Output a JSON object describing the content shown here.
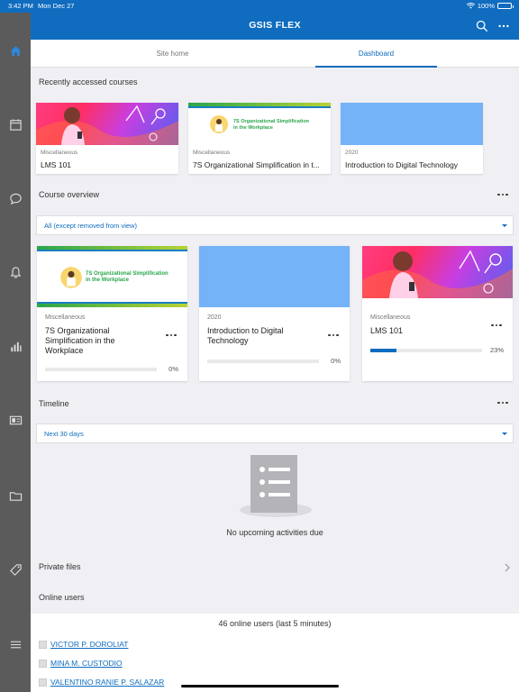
{
  "status": {
    "time": "3:42 PM",
    "date": "Mon Dec 27",
    "battery": "100%"
  },
  "header": {
    "title": "GSIS FLEX",
    "search_icon": "search-icon",
    "more_icon": "more-horizontal-icon"
  },
  "tabs": [
    {
      "label": "Site home",
      "active": false
    },
    {
      "label": "Dashboard",
      "active": true
    }
  ],
  "sidebar": {
    "items": [
      {
        "icon": "home-icon",
        "active": true
      },
      {
        "icon": "calendar-icon"
      },
      {
        "icon": "chat-bubble-icon"
      },
      {
        "icon": "bell-icon"
      },
      {
        "icon": "bar-chart-icon"
      },
      {
        "icon": "id-card-icon"
      },
      {
        "icon": "folder-icon"
      },
      {
        "icon": "tag-icon"
      },
      {
        "icon": "menu-icon"
      }
    ]
  },
  "recent": {
    "title": "Recently accessed courses",
    "courses": [
      {
        "category": "Miscellaneous",
        "name": "LMS 101",
        "image": "pink"
      },
      {
        "category": "Miscellaneous",
        "name": "7S Organizational Simplification in t...",
        "image": "7s"
      },
      {
        "category": "2020",
        "name": "Introduction to Digital Technology",
        "image": "blue"
      }
    ]
  },
  "overview": {
    "title": "Course overview",
    "filter": "All (except removed from view)",
    "courses": [
      {
        "category": "Miscellaneous",
        "name": "7S Organizational Simplification in the Workplace",
        "progress": 0,
        "progress_label": "0%",
        "image": "7s"
      },
      {
        "category": "2020",
        "name": "Introduction to Digital Technology",
        "progress": 0,
        "progress_label": "0%",
        "image": "blue"
      },
      {
        "category": "Miscellaneous",
        "name": "LMS 101",
        "progress": 23,
        "progress_label": "23%",
        "image": "pink"
      }
    ],
    "banner_text_line1": "7S Organizational Simplification",
    "banner_text_line2": "in the Workplace"
  },
  "timeline": {
    "title": "Timeline",
    "filter": "Next 30 days",
    "empty_message": "No upcoming activities due"
  },
  "private_files": {
    "label": "Private files"
  },
  "online_users": {
    "title": "Online users",
    "summary": "46 online users (last 5 minutes)",
    "users": [
      "VICTOR P. DOROLIAT",
      "MINA M. CUSTODIO",
      "VALENTINO RANIE P. SALAZAR"
    ]
  },
  "colors": {
    "brand": "#0f6cbf",
    "sidebar": "#5b5b5b",
    "background": "#efeff4"
  }
}
